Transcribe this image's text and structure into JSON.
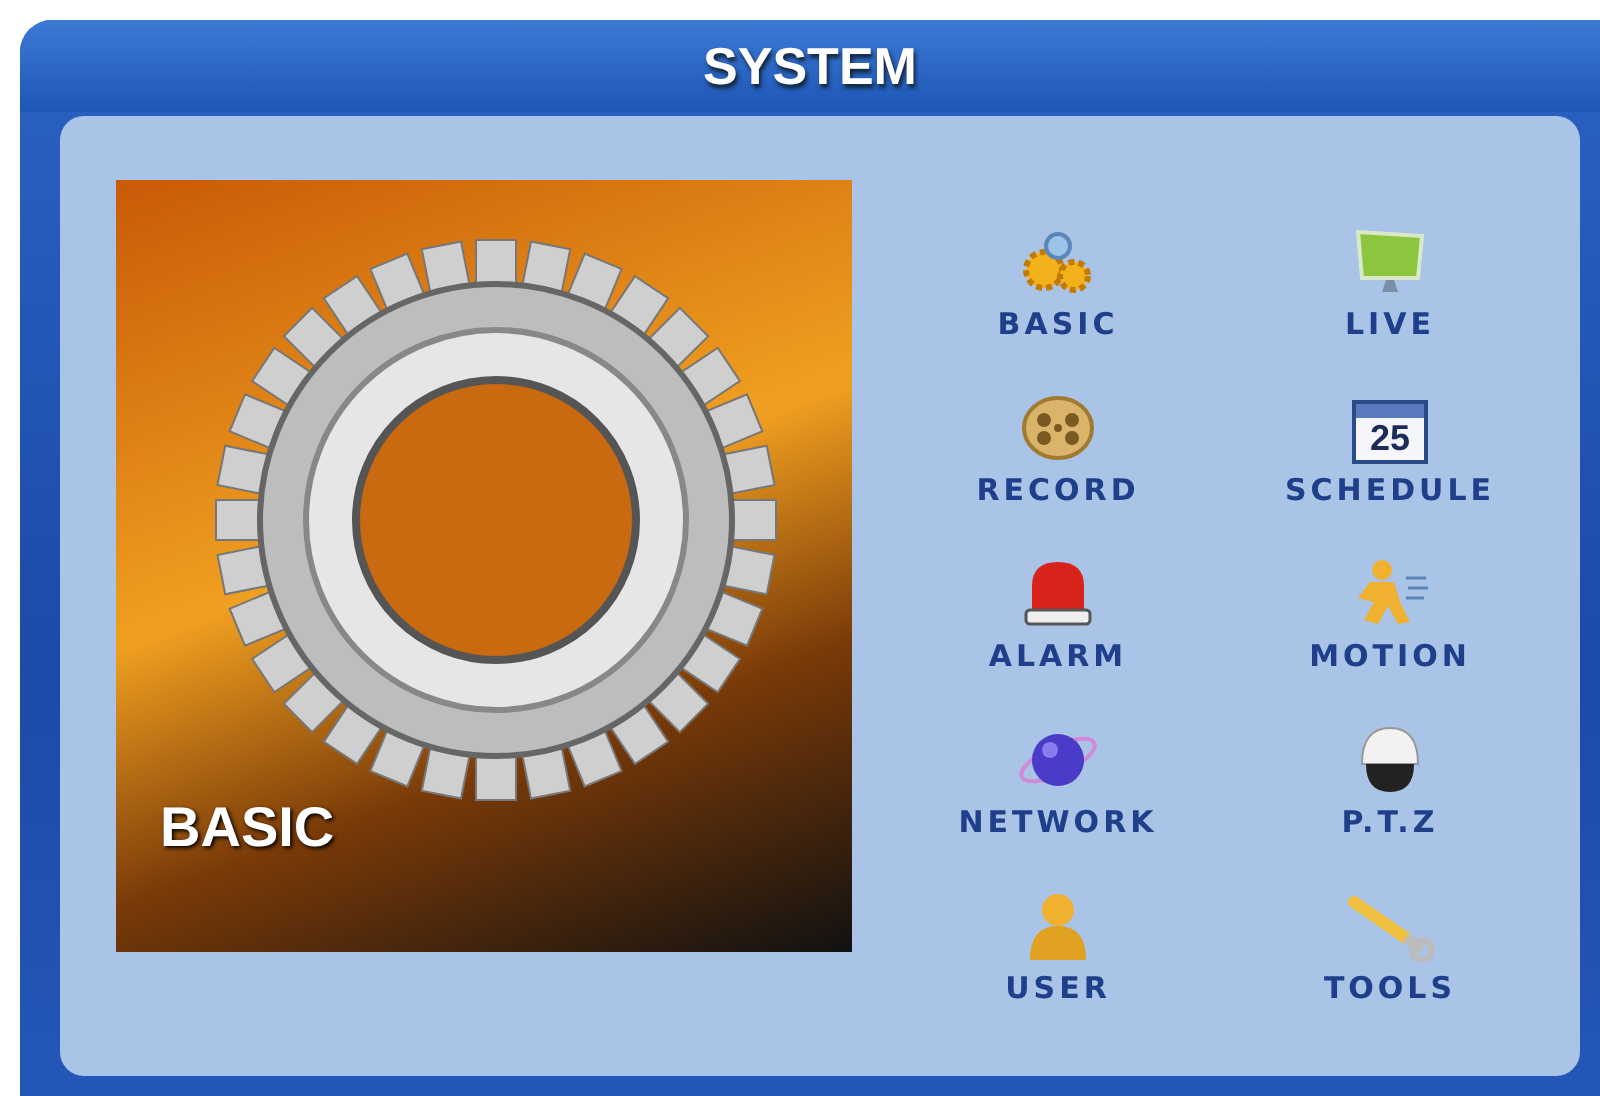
{
  "window": {
    "title": "SYSTEM"
  },
  "preview": {
    "caption": "BASIC"
  },
  "menu_rows": [
    [
      {
        "label": "BASIC",
        "kind": "gears"
      },
      {
        "label": "LIVE",
        "kind": "monitor"
      }
    ],
    [
      {
        "label": "RECORD",
        "kind": "reel"
      },
      {
        "label": "SCHEDULE",
        "kind": "calendar",
        "icon_text": "25"
      }
    ],
    [
      {
        "label": "ALARM",
        "kind": "siren"
      },
      {
        "label": "MOTION",
        "kind": "runner"
      }
    ],
    [
      {
        "label": "NETWORK",
        "kind": "globe"
      },
      {
        "label": "P.T.Z",
        "kind": "dome"
      }
    ],
    [
      {
        "label": "USER",
        "kind": "user"
      },
      {
        "label": "TOOLS",
        "kind": "wrench"
      }
    ]
  ]
}
